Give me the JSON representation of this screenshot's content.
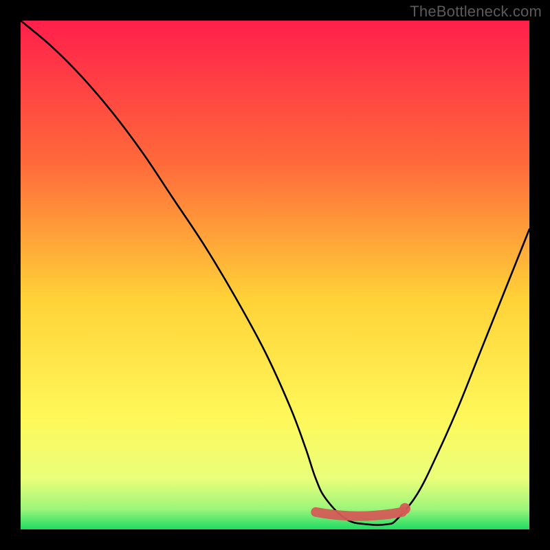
{
  "watermark": "TheBottleneck.com",
  "chart_data": {
    "type": "line",
    "title": "",
    "xlabel": "",
    "ylabel": "",
    "xlim": [
      0,
      100
    ],
    "ylim": [
      0,
      100
    ],
    "background": {
      "type": "vertical-gradient",
      "stops": [
        {
          "offset": 0,
          "color": "#ff1f4b"
        },
        {
          "offset": 28,
          "color": "#ff6a3a"
        },
        {
          "offset": 55,
          "color": "#ffd338"
        },
        {
          "offset": 78,
          "color": "#fff85a"
        },
        {
          "offset": 90,
          "color": "#eaff7a"
        },
        {
          "offset": 96,
          "color": "#9cf57a"
        },
        {
          "offset": 100,
          "color": "#1fdc64"
        }
      ]
    },
    "series": [
      {
        "name": "bottleneck-curve",
        "color": "#000000",
        "x": [
          0,
          6,
          12,
          18,
          24,
          30,
          36,
          42,
          48,
          53,
          56,
          58,
          60,
          64,
          68,
          72,
          74,
          78,
          82,
          86,
          90,
          94,
          98,
          100
        ],
        "y": [
          100,
          95,
          89,
          82,
          74,
          65,
          56,
          46,
          35,
          24,
          16,
          10,
          6,
          2,
          1,
          1,
          2,
          7,
          15,
          24,
          34,
          44,
          54,
          59
        ]
      }
    ],
    "highlight_band": {
      "name": "optimal-range",
      "color": "#d45a57",
      "x_start": 58,
      "x_end": 75,
      "y": 3
    }
  },
  "colors": {
    "frame": "#000000",
    "watermark": "#5b5b5b"
  }
}
